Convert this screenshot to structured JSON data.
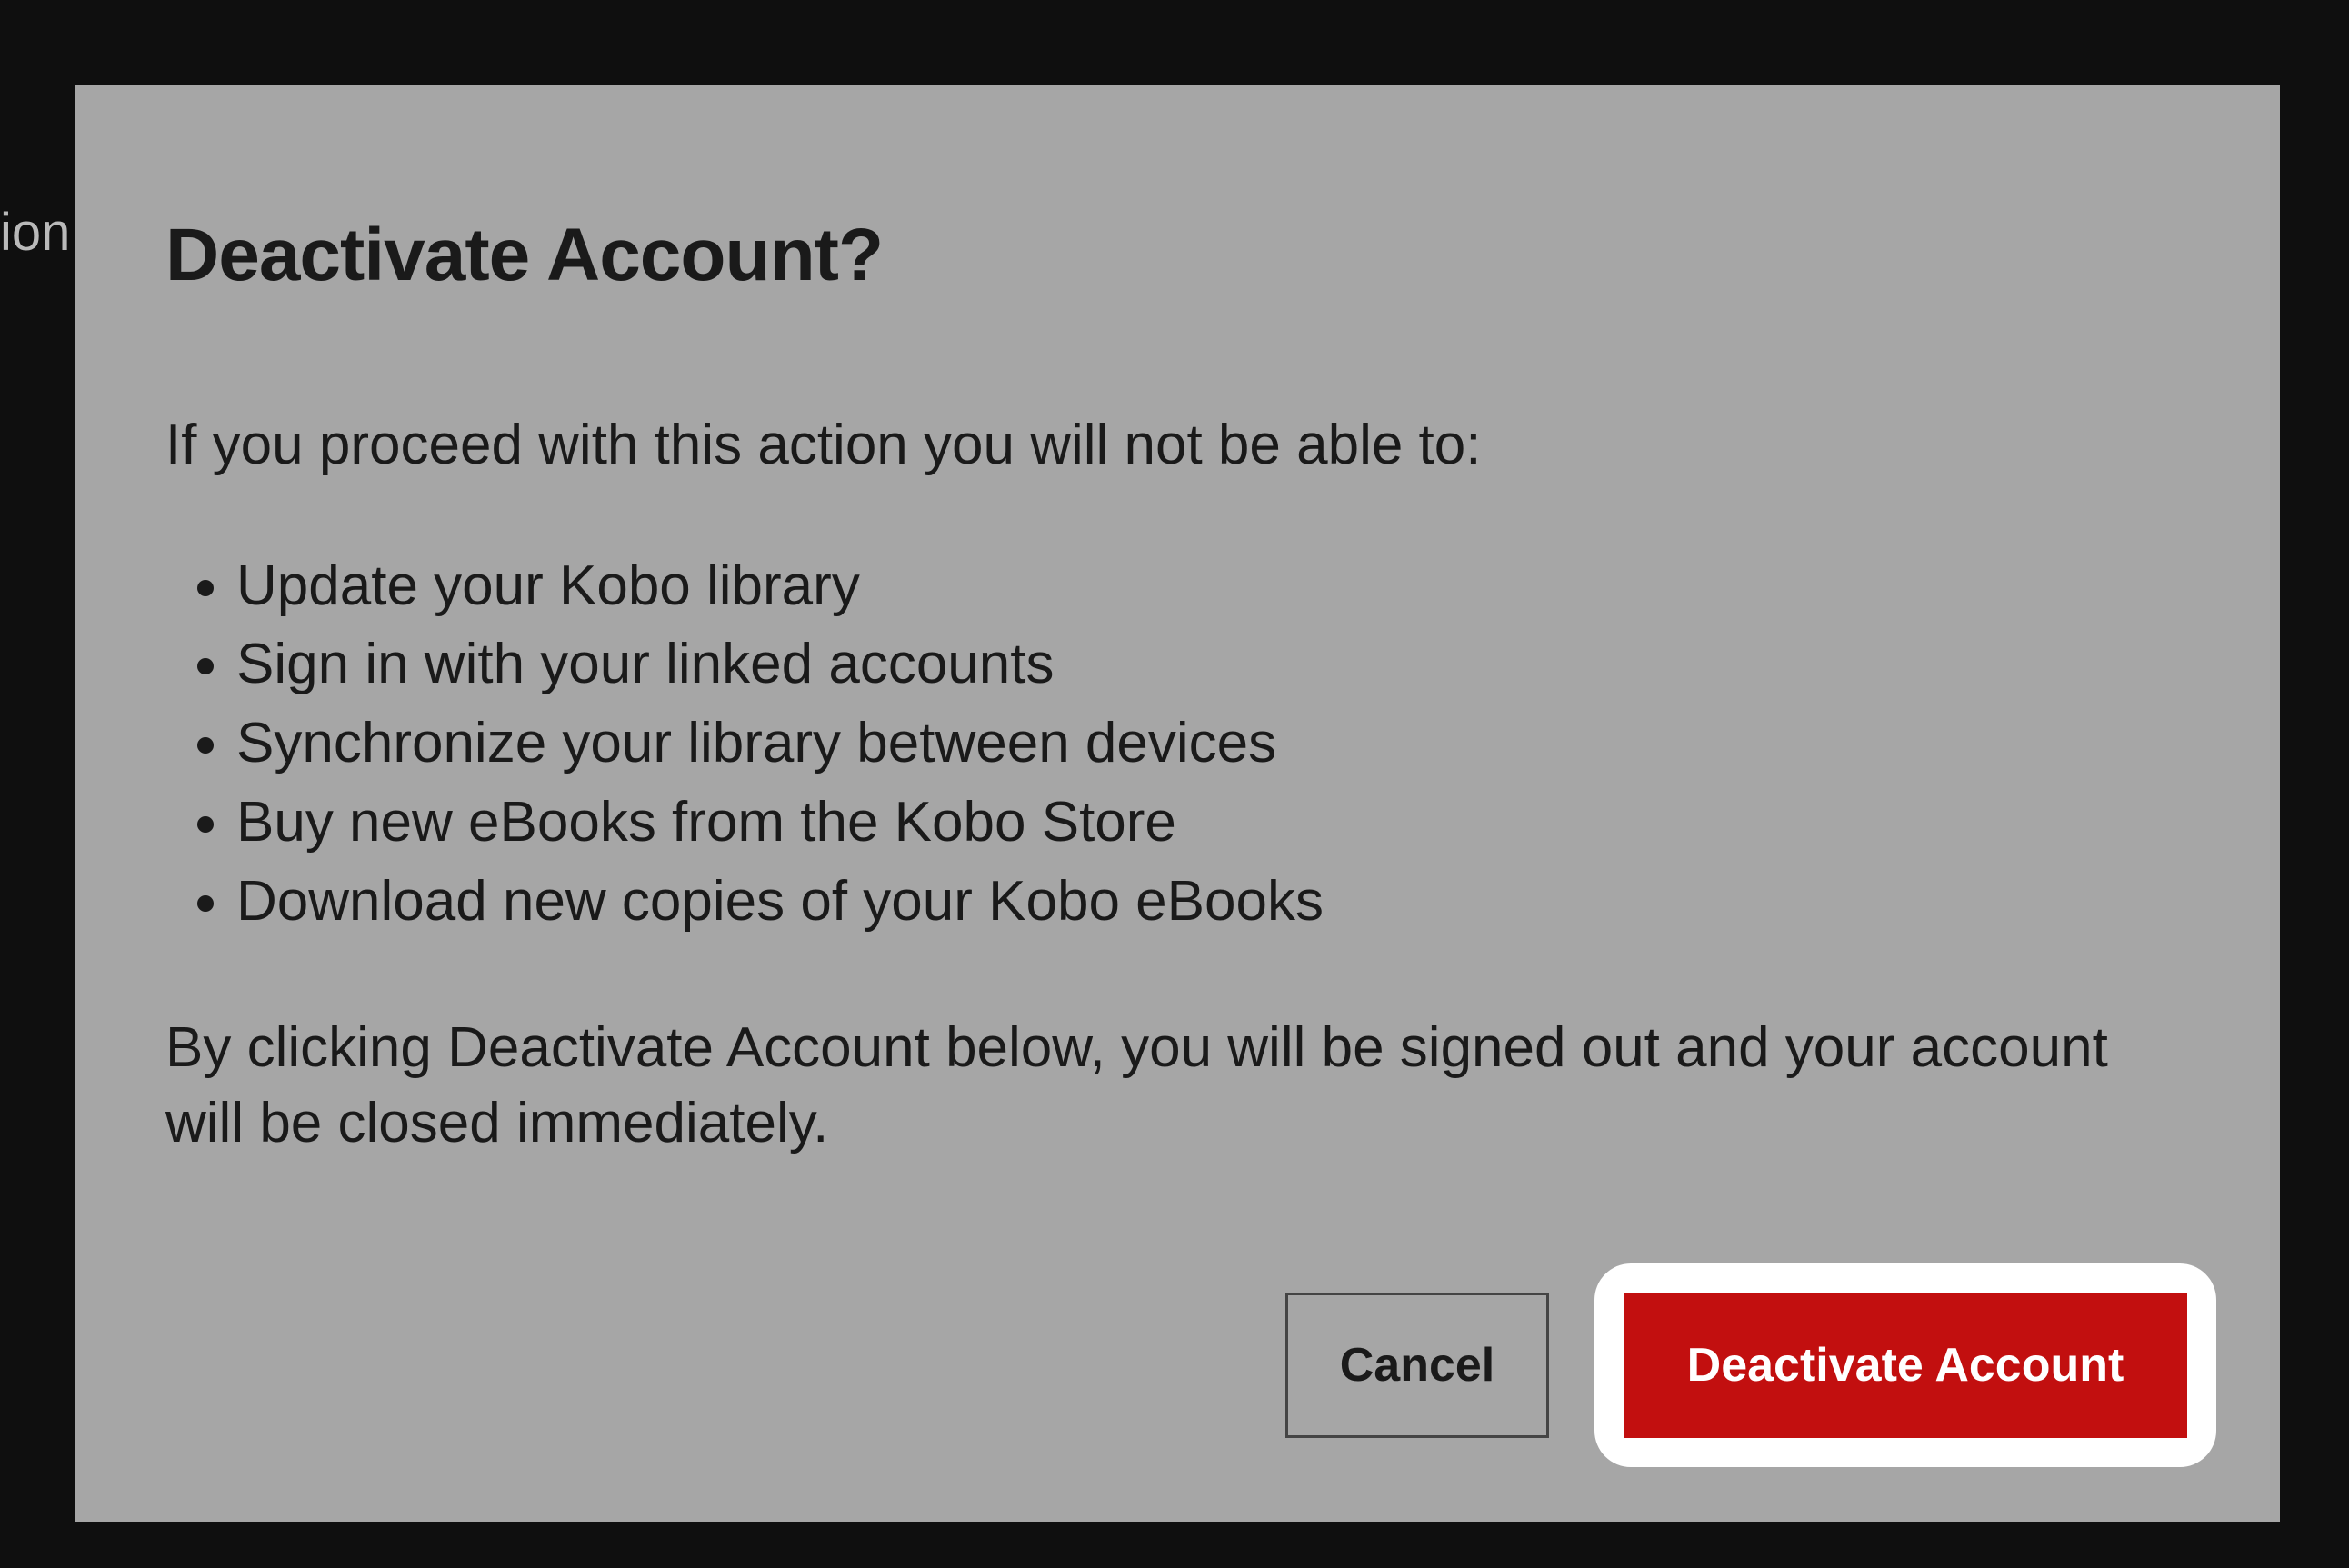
{
  "background": {
    "fragment_text": "ion"
  },
  "modal": {
    "title": "Deactivate Account?",
    "intro": "If you proceed with this action you will not be able to:",
    "bullets": {
      "0": "Update your Kobo library",
      "1": "Sign in with your linked accounts",
      "2": "Synchronize your library between devices",
      "3": "Buy new eBooks from the Kobo Store",
      "4": "Download new copies of your Kobo eBooks"
    },
    "outro": "By clicking Deactivate Account below, you will be signed out and your account will be closed immediately.",
    "buttons": {
      "cancel": "Cancel",
      "primary": "Deactivate Account"
    }
  },
  "colors": {
    "primary_button": "#c20f0f",
    "modal_bg": "#a6a6a6",
    "highlight": "#ffffff"
  }
}
